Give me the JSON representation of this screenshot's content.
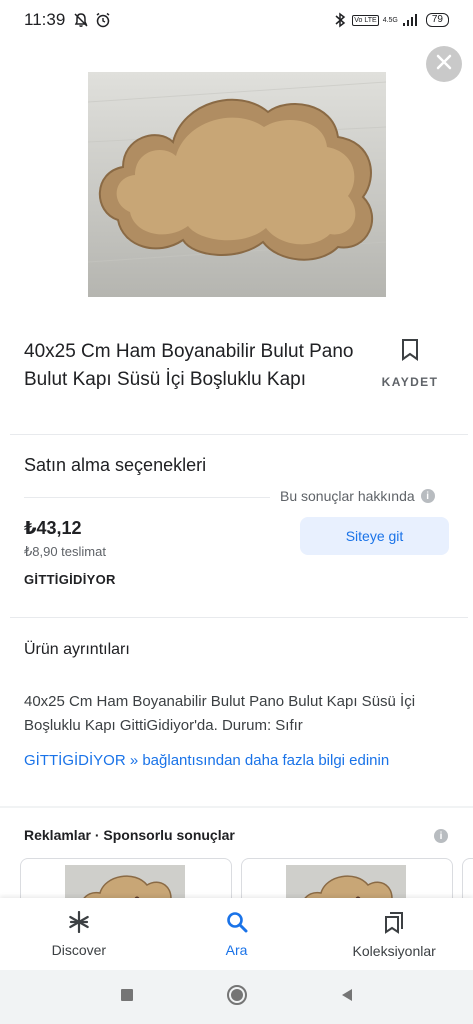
{
  "status_bar": {
    "time": "11:39",
    "network": "4.5G",
    "lte": "Vo LTE",
    "battery": "79"
  },
  "product": {
    "title": "40x25 Cm Ham Boyanabilir Bulut Pano Bulut Kapı Süsü İçi Boşluklu Kapı",
    "save_label": "KAYDET"
  },
  "purchase": {
    "section_title": "Satın alma seçenekleri",
    "about_results": "Bu sonuçlar hakkında",
    "price": "₺43,12",
    "shipping": "₺8,90 teslimat",
    "seller": "GİTTİGİDİYOR",
    "go_button": "Siteye git"
  },
  "details": {
    "section_title": "Ürün ayrıntıları",
    "description": "40x25 Cm Ham Boyanabilir Bulut Pano Bulut Kapı Süsü İçi Boşluklu Kapı GittiGidiyor'da. Durum: Sıfır",
    "link": "GİTTİGİDİYOR » bağlantısından daha fazla bilgi edinin"
  },
  "ads": {
    "header": "Reklamlar · Sponsorlu sonuçlar"
  },
  "bottom_nav": {
    "items": [
      {
        "label": "Discover",
        "icon": "asterisk-icon"
      },
      {
        "label": "Ara",
        "icon": "search-icon"
      },
      {
        "label": "Koleksiyonlar",
        "icon": "collections-icon"
      }
    ],
    "active_index": 1
  },
  "colors": {
    "accent": "#1a73e8",
    "button_bg": "#e8f0fe",
    "text_primary": "#202124",
    "text_secondary": "#5f6368"
  }
}
